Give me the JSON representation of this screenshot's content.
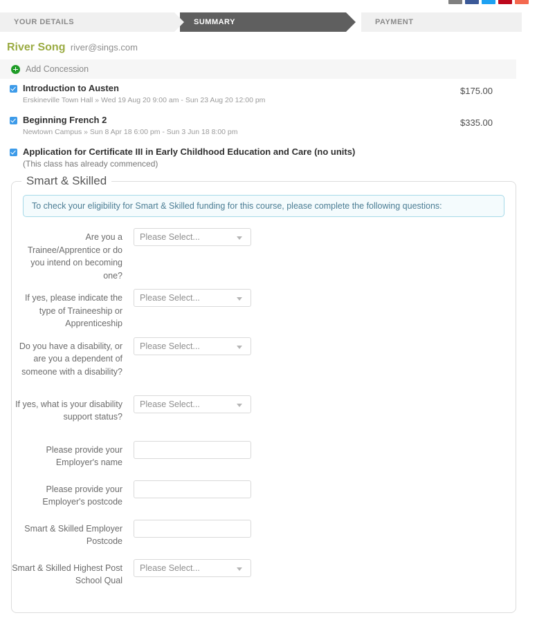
{
  "social": {
    "buttons": [
      {
        "name": "share-icon",
        "color": "#808080"
      },
      {
        "name": "facebook-icon",
        "color": "#3b5998"
      },
      {
        "name": "twitter-icon",
        "color": "#1da1f2"
      },
      {
        "name": "pinterest-icon",
        "color": "#bd081c"
      },
      {
        "name": "email-icon",
        "color": "#f4694f"
      }
    ]
  },
  "steps": [
    {
      "label": "YOUR DETAILS",
      "active": false
    },
    {
      "label": "SUMMARY",
      "active": true
    },
    {
      "label": "PAYMENT",
      "active": false
    }
  ],
  "customer": {
    "name": "River Song",
    "email": "river@sings.com",
    "name_color": "#9aab42"
  },
  "concession": {
    "label": "Add Concession",
    "icon": "plus-circle-icon"
  },
  "cart": {
    "items": [
      {
        "checked": true,
        "title": "Introduction to Austen",
        "subtitle": "Erskineville Town Hall » Wed 19 Aug 20 9:00 am - Sun 23 Aug 20 12:00 pm",
        "price": "$175.00"
      },
      {
        "checked": true,
        "title": "Beginning French 2",
        "subtitle": "Newtown Campus » Sun 8 Apr 18 6:00 pm - Sun 3 Jun 18 8:00 pm",
        "price": "$335.00"
      },
      {
        "checked": true,
        "title": "Application for Certificate III in Early Childhood Education and Care (no units)",
        "subtitle": "(This class has already commenced)",
        "price": ""
      }
    ]
  },
  "smart_skilled": {
    "legend": "Smart & Skilled",
    "info": "To check your eligibility for Smart & Skilled funding for this course, please complete the following questions:",
    "info_border_color": "#a6d9e8",
    "info_bg_color": "#f4fbfd",
    "select_placeholder": "Please Select...",
    "fields": [
      {
        "label": "Are you a Trainee/Apprentice or do you intend on becoming one?",
        "type": "select",
        "value": "Please Select...",
        "name": "trainee-apprentice-select"
      },
      {
        "label": "If yes, please indicate the type of Traineeship or Apprenticeship",
        "type": "select",
        "value": "Please Select...",
        "name": "traineeship-type-select"
      },
      {
        "label": "Do you have a disability, or are you a dependent of someone with a disability?",
        "type": "select",
        "value": "Please Select...",
        "name": "disability-select"
      },
      {
        "label": "If yes, what is your disability support status?",
        "type": "select",
        "value": "Please Select...",
        "name": "disability-support-status-select"
      },
      {
        "label": "Please provide your Employer's name",
        "type": "text",
        "value": "",
        "name": "employer-name-input"
      },
      {
        "label": "Please provide your Employer's postcode",
        "type": "text",
        "value": "",
        "name": "employer-postcode-input"
      },
      {
        "label": "Smart & Skilled Employer Postcode",
        "type": "text",
        "value": "",
        "name": "smart-skilled-employer-postcode-input"
      },
      {
        "label": "Smart & Skilled Highest Post School Qual",
        "type": "select",
        "value": "Please Select...",
        "name": "highest-post-school-qual-select"
      }
    ]
  }
}
